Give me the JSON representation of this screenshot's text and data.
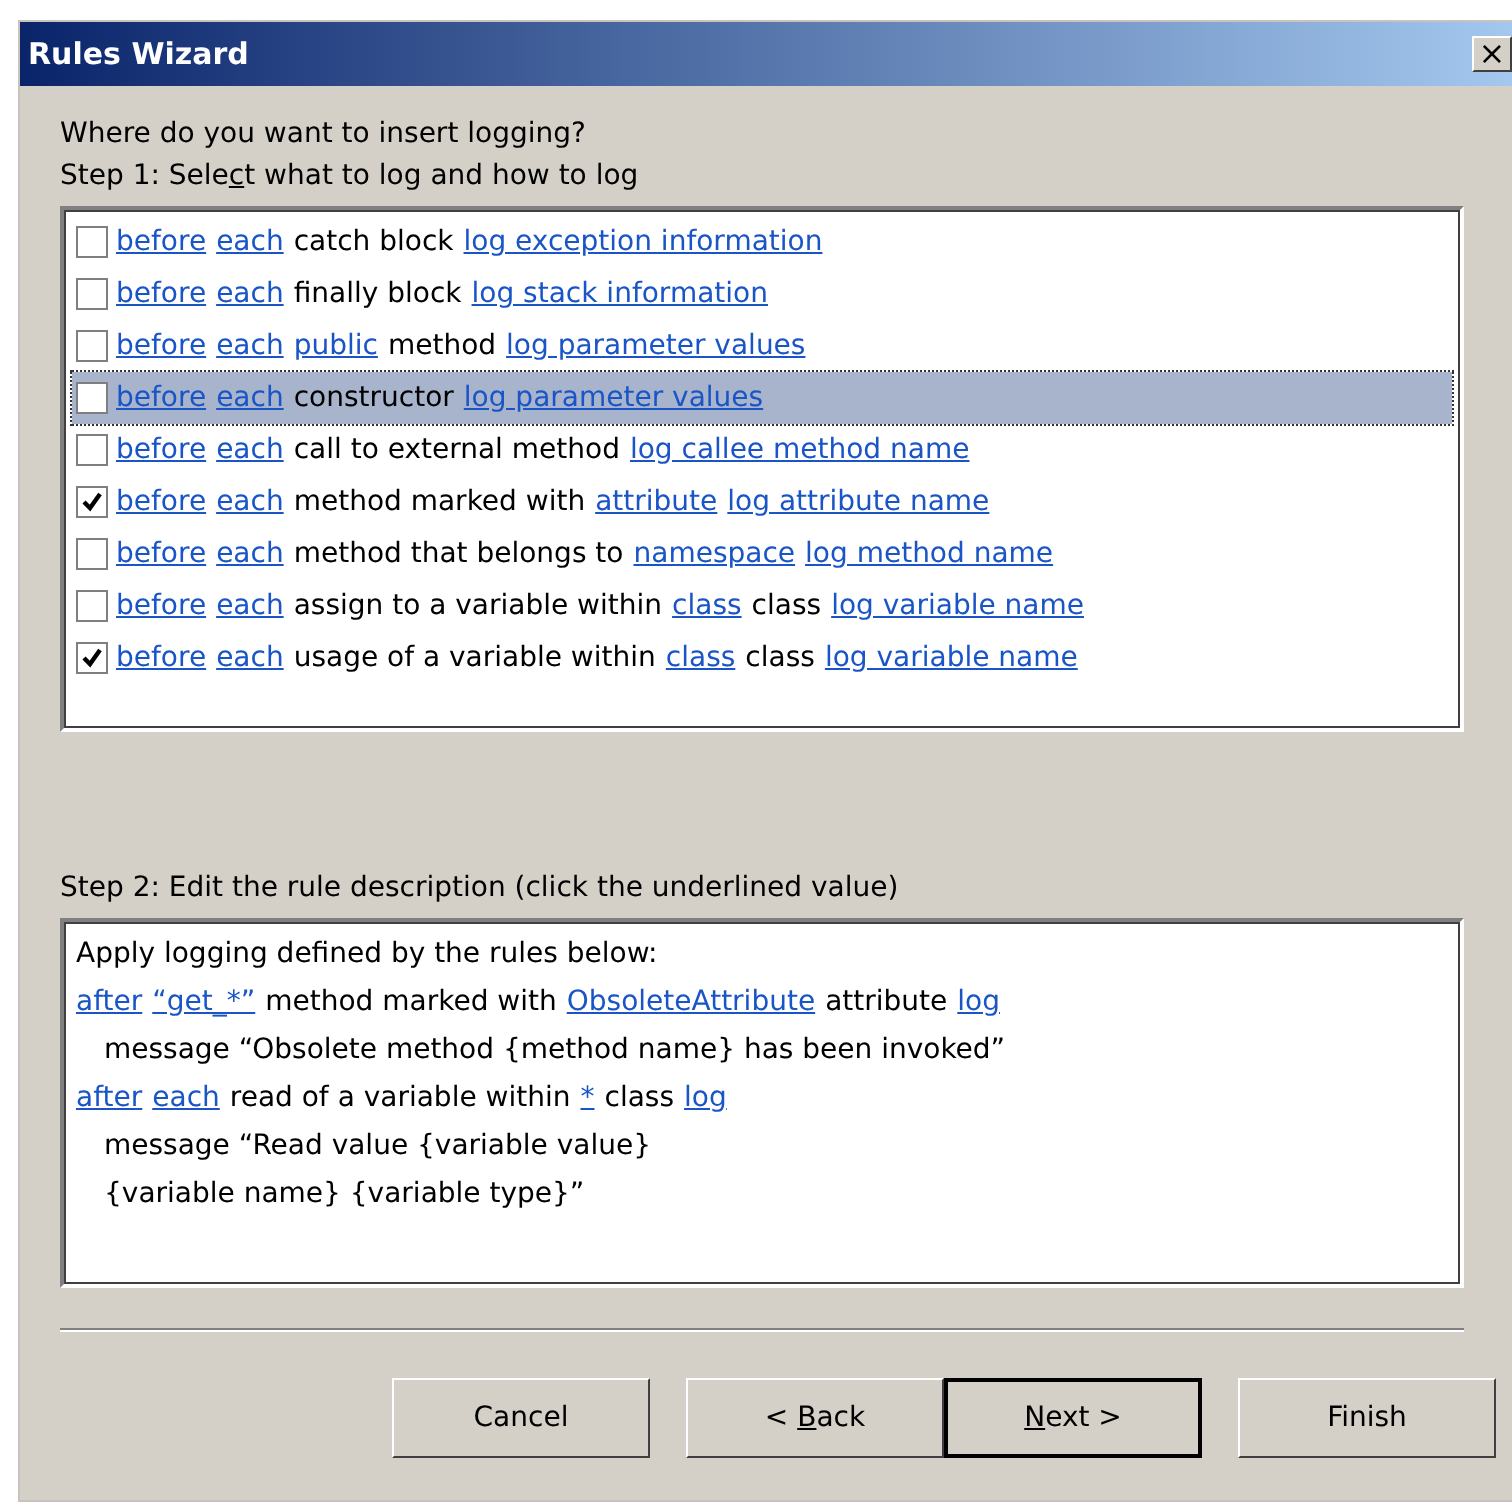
{
  "window": {
    "title": "Rules Wizard",
    "close": "×"
  },
  "heading": "Where do you want to insert logging?",
  "step1": {
    "pre": "Step 1: Sele",
    "key": "c",
    "post": "t what to log and how to log"
  },
  "rules": [
    {
      "checked": false,
      "selected": false,
      "segments": [
        {
          "kind": "link",
          "text": "before"
        },
        {
          "kind": "link",
          "text": "each"
        },
        {
          "kind": "text",
          "text": "catch block"
        },
        {
          "kind": "link",
          "text": "log exception information"
        }
      ]
    },
    {
      "checked": false,
      "selected": false,
      "segments": [
        {
          "kind": "link",
          "text": "before"
        },
        {
          "kind": "link",
          "text": "each"
        },
        {
          "kind": "text",
          "text": "finally block"
        },
        {
          "kind": "link",
          "text": "log stack information"
        }
      ]
    },
    {
      "checked": false,
      "selected": false,
      "segments": [
        {
          "kind": "link",
          "text": "before"
        },
        {
          "kind": "link",
          "text": "each"
        },
        {
          "kind": "link",
          "text": "public"
        },
        {
          "kind": "text",
          "text": "method"
        },
        {
          "kind": "link",
          "text": "log parameter values"
        }
      ]
    },
    {
      "checked": false,
      "selected": true,
      "segments": [
        {
          "kind": "link",
          "text": "before"
        },
        {
          "kind": "link",
          "text": "each"
        },
        {
          "kind": "text",
          "text": "constructor"
        },
        {
          "kind": "link",
          "text": "log parameter values"
        }
      ]
    },
    {
      "checked": false,
      "selected": false,
      "segments": [
        {
          "kind": "link",
          "text": "before"
        },
        {
          "kind": "link",
          "text": "each"
        },
        {
          "kind": "text",
          "text": "call to external method"
        },
        {
          "kind": "link",
          "text": "log callee method name"
        }
      ]
    },
    {
      "checked": true,
      "selected": false,
      "segments": [
        {
          "kind": "link",
          "text": "before"
        },
        {
          "kind": "link",
          "text": "each"
        },
        {
          "kind": "text",
          "text": "method marked with"
        },
        {
          "kind": "link",
          "text": "attribute"
        },
        {
          "kind": "link",
          "text": "log attribute name"
        }
      ]
    },
    {
      "checked": false,
      "selected": false,
      "segments": [
        {
          "kind": "link",
          "text": "before"
        },
        {
          "kind": "link",
          "text": "each"
        },
        {
          "kind": "text",
          "text": "method that belongs to"
        },
        {
          "kind": "link",
          "text": "namespace"
        },
        {
          "kind": "link",
          "text": "log method name"
        }
      ]
    },
    {
      "checked": false,
      "selected": false,
      "segments": [
        {
          "kind": "link",
          "text": "before"
        },
        {
          "kind": "link",
          "text": "each"
        },
        {
          "kind": "text",
          "text": "assign to a variable within"
        },
        {
          "kind": "link",
          "text": "class"
        },
        {
          "kind": "text",
          "text": "class"
        },
        {
          "kind": "link",
          "text": "log variable name"
        }
      ]
    },
    {
      "checked": true,
      "selected": false,
      "segments": [
        {
          "kind": "link",
          "text": "before"
        },
        {
          "kind": "link",
          "text": "each"
        },
        {
          "kind": "text",
          "text": "usage of a variable within"
        },
        {
          "kind": "link",
          "text": "class"
        },
        {
          "kind": "text",
          "text": "class"
        },
        {
          "kind": "link",
          "text": "log variable name"
        }
      ]
    }
  ],
  "step2": "Step 2: Edit the rule description (click the underlined value)",
  "description": [
    {
      "indented": false,
      "segments": [
        {
          "kind": "text",
          "text": "Apply logging defined by the rules below:"
        }
      ]
    },
    {
      "indented": false,
      "segments": [
        {
          "kind": "link",
          "text": "after"
        },
        {
          "kind": "link",
          "text": "“get_*”"
        },
        {
          "kind": "text",
          "text": "method marked with"
        },
        {
          "kind": "link",
          "text": "ObsoleteAttribute"
        },
        {
          "kind": "text",
          "text": "attribute"
        },
        {
          "kind": "link",
          "text": "log"
        }
      ]
    },
    {
      "indented": true,
      "segments": [
        {
          "kind": "text",
          "text": "message “Obsolete method {method name} has been invoked”"
        }
      ]
    },
    {
      "indented": false,
      "segments": [
        {
          "kind": "link",
          "text": "after"
        },
        {
          "kind": "link",
          "text": "each"
        },
        {
          "kind": "text",
          "text": "read of a variable within"
        },
        {
          "kind": "link",
          "text": "*"
        },
        {
          "kind": "text",
          "text": "class"
        },
        {
          "kind": "link",
          "text": "log"
        }
      ]
    },
    {
      "indented": true,
      "segments": [
        {
          "kind": "text",
          "text": "message “Read value {variable value}"
        }
      ]
    },
    {
      "indented": true,
      "segments": [
        {
          "kind": "text",
          "text": "{variable name} {variable type}”"
        }
      ]
    }
  ],
  "buttons": [
    {
      "pre": "Cancel",
      "default": false
    },
    {
      "pre": "< ",
      "key": "B",
      "post": "ack",
      "default": false
    },
    {
      "key": "N",
      "post": "ext >",
      "default": true
    },
    {
      "pre": "Finish",
      "default": false
    }
  ]
}
